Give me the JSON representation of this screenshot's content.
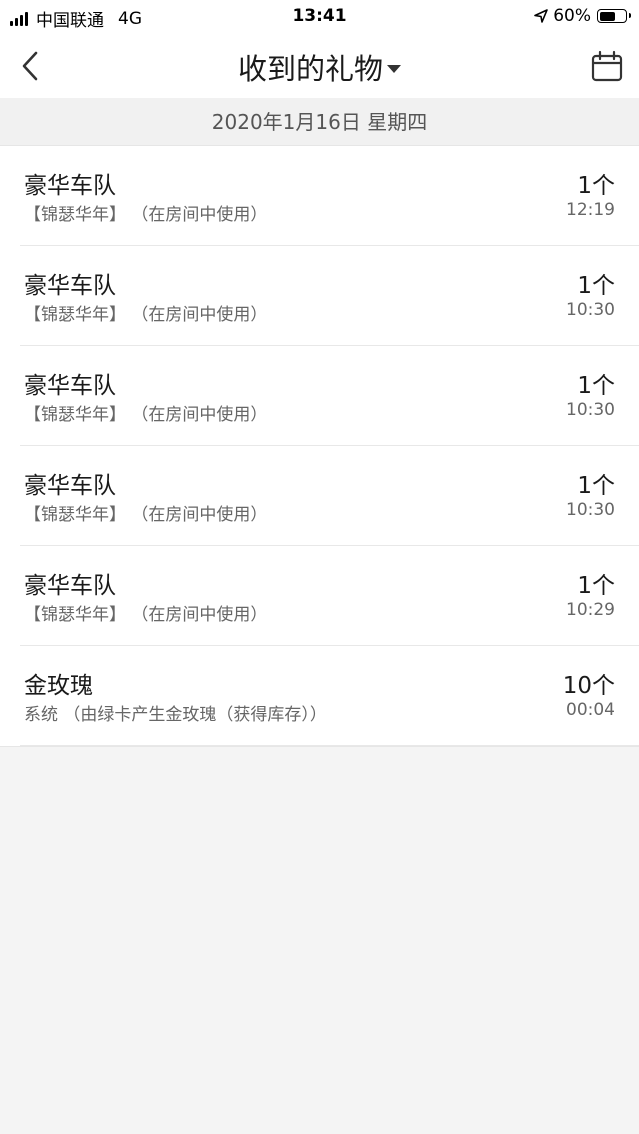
{
  "status_bar": {
    "carrier": "中国联通",
    "network": "4G",
    "time": "13:41",
    "battery_percent": "60%",
    "battery_level": 0.6
  },
  "nav": {
    "title": "收到的礼物"
  },
  "date_header": "2020年1月16日 星期四",
  "gifts": [
    {
      "name": "豪华车队",
      "desc": "【锦瑟华年】 （在房间中使用）",
      "count": "1个",
      "time": "12:19"
    },
    {
      "name": "豪华车队",
      "desc": "【锦瑟华年】 （在房间中使用）",
      "count": "1个",
      "time": "10:30"
    },
    {
      "name": "豪华车队",
      "desc": "【锦瑟华年】 （在房间中使用）",
      "count": "1个",
      "time": "10:30"
    },
    {
      "name": "豪华车队",
      "desc": "【锦瑟华年】 （在房间中使用）",
      "count": "1个",
      "time": "10:30"
    },
    {
      "name": "豪华车队",
      "desc": "【锦瑟华年】 （在房间中使用）",
      "count": "1个",
      "time": "10:29"
    },
    {
      "name": "金玫瑰",
      "desc": "系统 （由绿卡产生金玫瑰（获得库存））",
      "count": "10个",
      "time": "00:04"
    }
  ],
  "icons": {
    "back": "chevron-left-icon",
    "calendar": "calendar-icon",
    "title_dropdown": "caret-down-icon",
    "location": "location-arrow-icon"
  }
}
